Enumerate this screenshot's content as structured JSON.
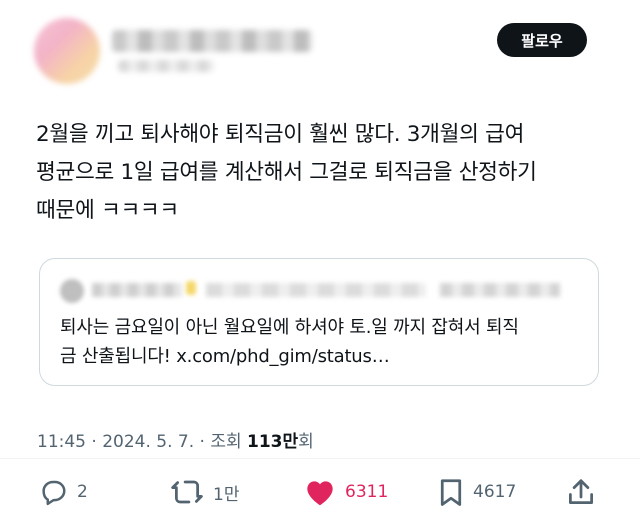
{
  "header": {
    "follow_label": "팔로우"
  },
  "tweet": {
    "lines": [
      "2월을 끼고 퇴사해야 퇴직금이 훨씬 많다.  3개월의 급여",
      "평균으로 1일 급여를 계산해서 그걸로 퇴직금을 산정하기",
      "때문에 ㅋㅋㅋㅋ"
    ]
  },
  "quote": {
    "lines": [
      "퇴사는 금요일이 아닌 월요일에 하셔야 토.일 까지 잡혀서 퇴직",
      "금 산출됩니다! x.com/phd_gim/status…"
    ]
  },
  "meta": {
    "prefix": "11:45 · 2024. 5. 7. · 조회 ",
    "views": "113만",
    "suffix": "회"
  },
  "actions": {
    "reply_count": "2",
    "retweet_count": "1만",
    "like_count": "6311",
    "bookmark_count": "4617"
  },
  "colors": {
    "like": "#e0245e",
    "text": "#0f1419",
    "muted": "#536471",
    "button_bg": "#0f1419"
  }
}
